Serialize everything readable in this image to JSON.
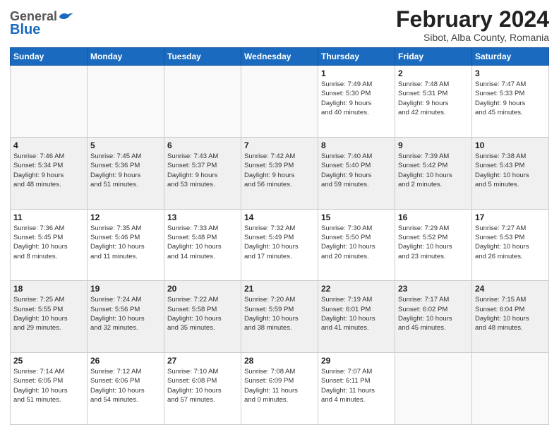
{
  "header": {
    "logo_general": "General",
    "logo_blue": "Blue",
    "main_title": "February 2024",
    "sub_title": "Sibot, Alba County, Romania"
  },
  "days_of_week": [
    "Sunday",
    "Monday",
    "Tuesday",
    "Wednesday",
    "Thursday",
    "Friday",
    "Saturday"
  ],
  "weeks": [
    [
      {
        "day": "",
        "info": ""
      },
      {
        "day": "",
        "info": ""
      },
      {
        "day": "",
        "info": ""
      },
      {
        "day": "",
        "info": ""
      },
      {
        "day": "1",
        "info": "Sunrise: 7:49 AM\nSunset: 5:30 PM\nDaylight: 9 hours\nand 40 minutes."
      },
      {
        "day": "2",
        "info": "Sunrise: 7:48 AM\nSunset: 5:31 PM\nDaylight: 9 hours\nand 42 minutes."
      },
      {
        "day": "3",
        "info": "Sunrise: 7:47 AM\nSunset: 5:33 PM\nDaylight: 9 hours\nand 45 minutes."
      }
    ],
    [
      {
        "day": "4",
        "info": "Sunrise: 7:46 AM\nSunset: 5:34 PM\nDaylight: 9 hours\nand 48 minutes."
      },
      {
        "day": "5",
        "info": "Sunrise: 7:45 AM\nSunset: 5:36 PM\nDaylight: 9 hours\nand 51 minutes."
      },
      {
        "day": "6",
        "info": "Sunrise: 7:43 AM\nSunset: 5:37 PM\nDaylight: 9 hours\nand 53 minutes."
      },
      {
        "day": "7",
        "info": "Sunrise: 7:42 AM\nSunset: 5:39 PM\nDaylight: 9 hours\nand 56 minutes."
      },
      {
        "day": "8",
        "info": "Sunrise: 7:40 AM\nSunset: 5:40 PM\nDaylight: 9 hours\nand 59 minutes."
      },
      {
        "day": "9",
        "info": "Sunrise: 7:39 AM\nSunset: 5:42 PM\nDaylight: 10 hours\nand 2 minutes."
      },
      {
        "day": "10",
        "info": "Sunrise: 7:38 AM\nSunset: 5:43 PM\nDaylight: 10 hours\nand 5 minutes."
      }
    ],
    [
      {
        "day": "11",
        "info": "Sunrise: 7:36 AM\nSunset: 5:45 PM\nDaylight: 10 hours\nand 8 minutes."
      },
      {
        "day": "12",
        "info": "Sunrise: 7:35 AM\nSunset: 5:46 PM\nDaylight: 10 hours\nand 11 minutes."
      },
      {
        "day": "13",
        "info": "Sunrise: 7:33 AM\nSunset: 5:48 PM\nDaylight: 10 hours\nand 14 minutes."
      },
      {
        "day": "14",
        "info": "Sunrise: 7:32 AM\nSunset: 5:49 PM\nDaylight: 10 hours\nand 17 minutes."
      },
      {
        "day": "15",
        "info": "Sunrise: 7:30 AM\nSunset: 5:50 PM\nDaylight: 10 hours\nand 20 minutes."
      },
      {
        "day": "16",
        "info": "Sunrise: 7:29 AM\nSunset: 5:52 PM\nDaylight: 10 hours\nand 23 minutes."
      },
      {
        "day": "17",
        "info": "Sunrise: 7:27 AM\nSunset: 5:53 PM\nDaylight: 10 hours\nand 26 minutes."
      }
    ],
    [
      {
        "day": "18",
        "info": "Sunrise: 7:25 AM\nSunset: 5:55 PM\nDaylight: 10 hours\nand 29 minutes."
      },
      {
        "day": "19",
        "info": "Sunrise: 7:24 AM\nSunset: 5:56 PM\nDaylight: 10 hours\nand 32 minutes."
      },
      {
        "day": "20",
        "info": "Sunrise: 7:22 AM\nSunset: 5:58 PM\nDaylight: 10 hours\nand 35 minutes."
      },
      {
        "day": "21",
        "info": "Sunrise: 7:20 AM\nSunset: 5:59 PM\nDaylight: 10 hours\nand 38 minutes."
      },
      {
        "day": "22",
        "info": "Sunrise: 7:19 AM\nSunset: 6:01 PM\nDaylight: 10 hours\nand 41 minutes."
      },
      {
        "day": "23",
        "info": "Sunrise: 7:17 AM\nSunset: 6:02 PM\nDaylight: 10 hours\nand 45 minutes."
      },
      {
        "day": "24",
        "info": "Sunrise: 7:15 AM\nSunset: 6:04 PM\nDaylight: 10 hours\nand 48 minutes."
      }
    ],
    [
      {
        "day": "25",
        "info": "Sunrise: 7:14 AM\nSunset: 6:05 PM\nDaylight: 10 hours\nand 51 minutes."
      },
      {
        "day": "26",
        "info": "Sunrise: 7:12 AM\nSunset: 6:06 PM\nDaylight: 10 hours\nand 54 minutes."
      },
      {
        "day": "27",
        "info": "Sunrise: 7:10 AM\nSunset: 6:08 PM\nDaylight: 10 hours\nand 57 minutes."
      },
      {
        "day": "28",
        "info": "Sunrise: 7:08 AM\nSunset: 6:09 PM\nDaylight: 11 hours\nand 0 minutes."
      },
      {
        "day": "29",
        "info": "Sunrise: 7:07 AM\nSunset: 6:11 PM\nDaylight: 11 hours\nand 4 minutes."
      },
      {
        "day": "",
        "info": ""
      },
      {
        "day": "",
        "info": ""
      }
    ]
  ]
}
